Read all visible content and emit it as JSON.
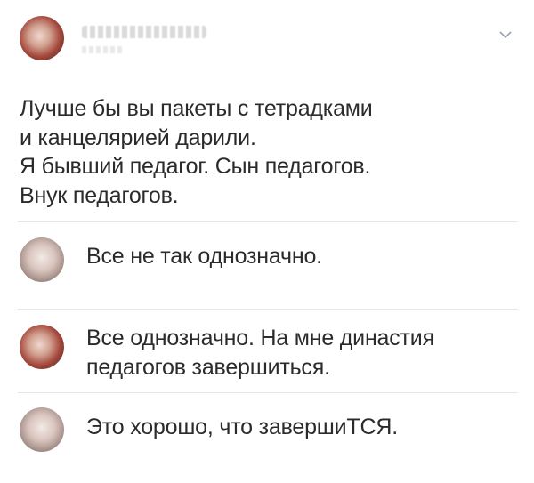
{
  "tweet": {
    "lines": [
      "Лучше бы вы пакеты с тетрадками",
      "и канцелярией дарили.",
      "Я бывший педагог. Сын педагогов.",
      "Внук педагогов."
    ]
  },
  "replies": [
    {
      "lines": [
        "Все не так однозначно."
      ]
    },
    {
      "lines": [
        "Все однозначно. На мне династия",
        "педагогов завершиться."
      ]
    },
    {
      "lines": [
        "Это хорошо, что завершиТСЯ."
      ]
    }
  ],
  "icons": {
    "menu": "chevron-down-icon"
  },
  "colors": {
    "text": "#2b2b2b",
    "divider": "#e6e6e6"
  }
}
